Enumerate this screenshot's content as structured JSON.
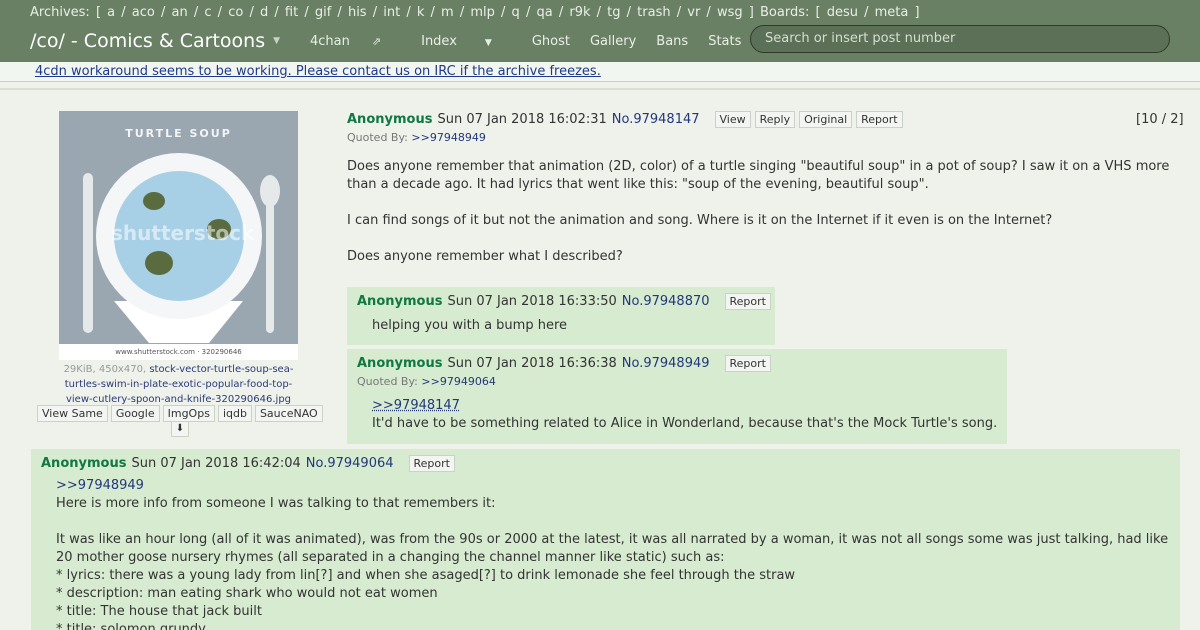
{
  "header": {
    "archives_label": "Archives:",
    "archives": [
      "a",
      "aco",
      "an",
      "c",
      "co",
      "d",
      "fit",
      "gif",
      "his",
      "int",
      "k",
      "m",
      "mlp",
      "q",
      "qa",
      "r9k",
      "tg",
      "trash",
      "vr",
      "wsg"
    ],
    "boards_label": "Boards:",
    "boards": [
      "desu",
      "meta"
    ],
    "board_title": "/co/ - Comics & Cartoons",
    "nav": [
      "4chan",
      "Index",
      "Ghost",
      "Gallery",
      "Bans",
      "Stats"
    ],
    "search_placeholder": "Search or insert post number"
  },
  "notice": "4cdn workaround seems to be working. Please contact us on IRC if the archive freezes.",
  "thumbnail": {
    "image_title": "TURTLE SOUP",
    "watermark": "shutterstock",
    "footer": "www.shutterstock.com · 320290646"
  },
  "file": {
    "meta": "29KiB, 450x470,",
    "filename": "stock-vector-turtle-soup-sea-turtles-swim-in-plate-exotic-popular-food-top-view-cutlery-spoon-and-knife-320290646.jpg",
    "buttons": [
      "View Same",
      "Google",
      "ImgOps",
      "iqdb",
      "SauceNAO"
    ],
    "download_icon": "download-icon"
  },
  "op": {
    "name": "Anonymous",
    "date": "Sun 07 Jan 2018 16:02:31",
    "number": "No.97948147",
    "buttons": [
      "View",
      "Reply",
      "Original",
      "Report"
    ],
    "quoted_label": "Quoted By:",
    "quoted_by": ">>97948949",
    "count": "[10 / 2]",
    "paragraphs": [
      "Does anyone remember that animation (2D, color) of a turtle singing \"beautiful soup\" in a pot of soup? I saw it on a VHS more than a decade ago. It had lyrics that went like this: \"soup of the evening, beautiful soup\".",
      "I can find songs of it but not the animation and song. Where is it on the Internet if it even is on the Internet?",
      "Does anyone remember what I described?"
    ]
  },
  "replies": [
    {
      "name": "Anonymous",
      "date": "Sun 07 Jan 2018 16:33:50",
      "number": "No.97948870",
      "report": "Report",
      "lines": [
        "helping you with a bump here"
      ]
    },
    {
      "name": "Anonymous",
      "date": "Sun 07 Jan 2018 16:36:38",
      "number": "No.97948949",
      "report": "Report",
      "quoted_label": "Quoted By:",
      "quoted_by": ">>97949064",
      "quote_link": ">>97948147",
      "lines": [
        "It'd have to be something related to Alice in Wonderland, because that's the Mock Turtle's song."
      ]
    },
    {
      "name": "Anonymous",
      "date": "Sun 07 Jan 2018 16:42:04",
      "number": "No.97949064",
      "report": "Report",
      "quote_link": ">>97948949",
      "lines": [
        "Here is more info from someone I was talking to that remembers it:",
        "",
        "It was like an hour long (all of it was animated), was from the 90s or 2000 at the latest, it was all narrated by a woman, it was not all songs some was just talking, had like 20 mother goose nursery rhymes (all separated in a changing the channel manner like static) such as:",
        "* lyrics: there was a young lady from lin[?] and when she asaged[?] to drink lemonade she feel through the straw",
        "* description: man eating shark who would not eat women",
        "* title: The house that jack built",
        "* title: solomon grundy"
      ]
    }
  ]
}
